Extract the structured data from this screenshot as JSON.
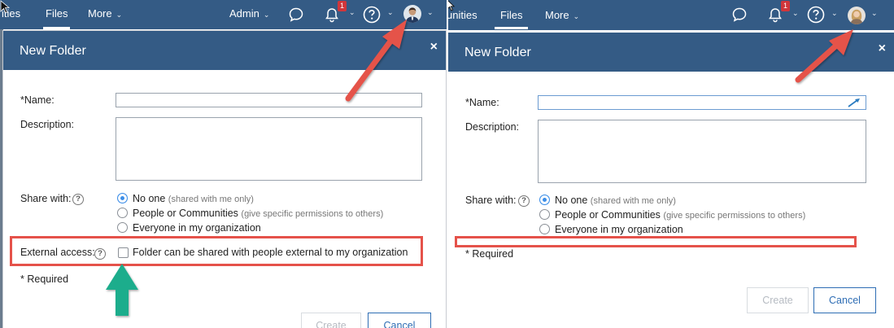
{
  "left": {
    "nav": {
      "cut_item": "ities",
      "files": "Files",
      "more": "More",
      "admin": "Admin",
      "notification_count": "1"
    },
    "dialog": {
      "title": "New Folder",
      "close": "×",
      "name_label": "*Name:",
      "description_label": "Description:",
      "share_label": "Share with:",
      "share_options": [
        {
          "label": "No one",
          "hint": "(shared with me only)",
          "selected": true
        },
        {
          "label": "People or Communities",
          "hint": "(give specific permissions to others)",
          "selected": false
        },
        {
          "label": "Everyone in my organization",
          "hint": "",
          "selected": false
        }
      ],
      "external_label": "External access:",
      "external_checkbox_label": "Folder can be shared with people external to my organization",
      "external_checked": false,
      "required_note": "* Required",
      "create_label": "Create",
      "cancel_label": "Cancel"
    }
  },
  "right": {
    "nav": {
      "cut_item": "unities",
      "files": "Files",
      "more": "More",
      "notification_count": "1"
    },
    "dialog": {
      "title": "New Folder",
      "close": "×",
      "name_label": "*Name:",
      "description_label": "Description:",
      "share_label": "Share with:",
      "share_options": [
        {
          "label": "No one",
          "hint": "(shared with me only)",
          "selected": true
        },
        {
          "label": "People or Communities",
          "hint": "(give specific permissions to others)",
          "selected": false
        },
        {
          "label": "Everyone in my organization",
          "hint": "",
          "selected": false
        }
      ],
      "required_note": "* Required",
      "create_label": "Create",
      "cancel_label": "Cancel"
    }
  },
  "icons": {
    "chat": "chat-bubble-icon",
    "bell": "bell-icon",
    "help": "help-circle-icon",
    "avatar": "user-avatar",
    "pointer": "mouse-pointer-icon"
  },
  "colors": {
    "header": "#345b85",
    "highlight": "#e5524a",
    "arrow_red": "#e5524a",
    "arrow_green": "#1fad8c",
    "radio_selected": "#3c8ee8",
    "cancel": "#2e6db4",
    "badge": "#d0363b"
  }
}
